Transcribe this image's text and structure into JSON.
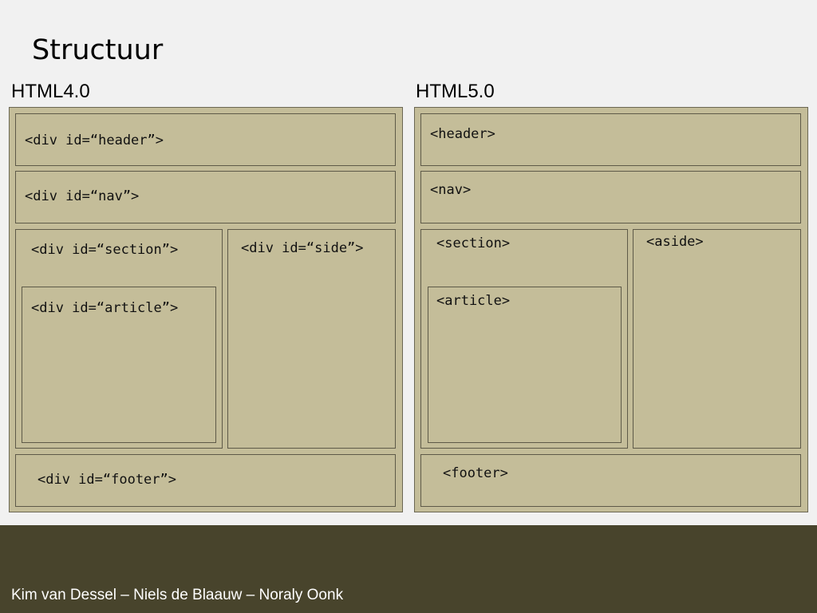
{
  "slide": {
    "title": "Structuur",
    "authors": "Kim van Dessel – Niels de Blaauw – Noraly Oonk",
    "colors": {
      "background": "#f1f1f1",
      "box_fill": "#c4bd99",
      "box_border": "#5e5a48",
      "footer_band": "#48442c",
      "footer_text": "#ffffff"
    }
  },
  "left": {
    "heading": "HTML4.0",
    "header": "<div id=“header”>",
    "nav": "<div id=“nav”>",
    "section": "<div id=“section”>",
    "article": "<div id=“article”>",
    "side": "<div id=“side”>",
    "footer": "<div id=“footer”>"
  },
  "right": {
    "heading": "HTML5.0",
    "header": "<header>",
    "nav": "<nav>",
    "section": "<section>",
    "article": "<article>",
    "aside": "<aside>",
    "footer": "<footer>"
  }
}
